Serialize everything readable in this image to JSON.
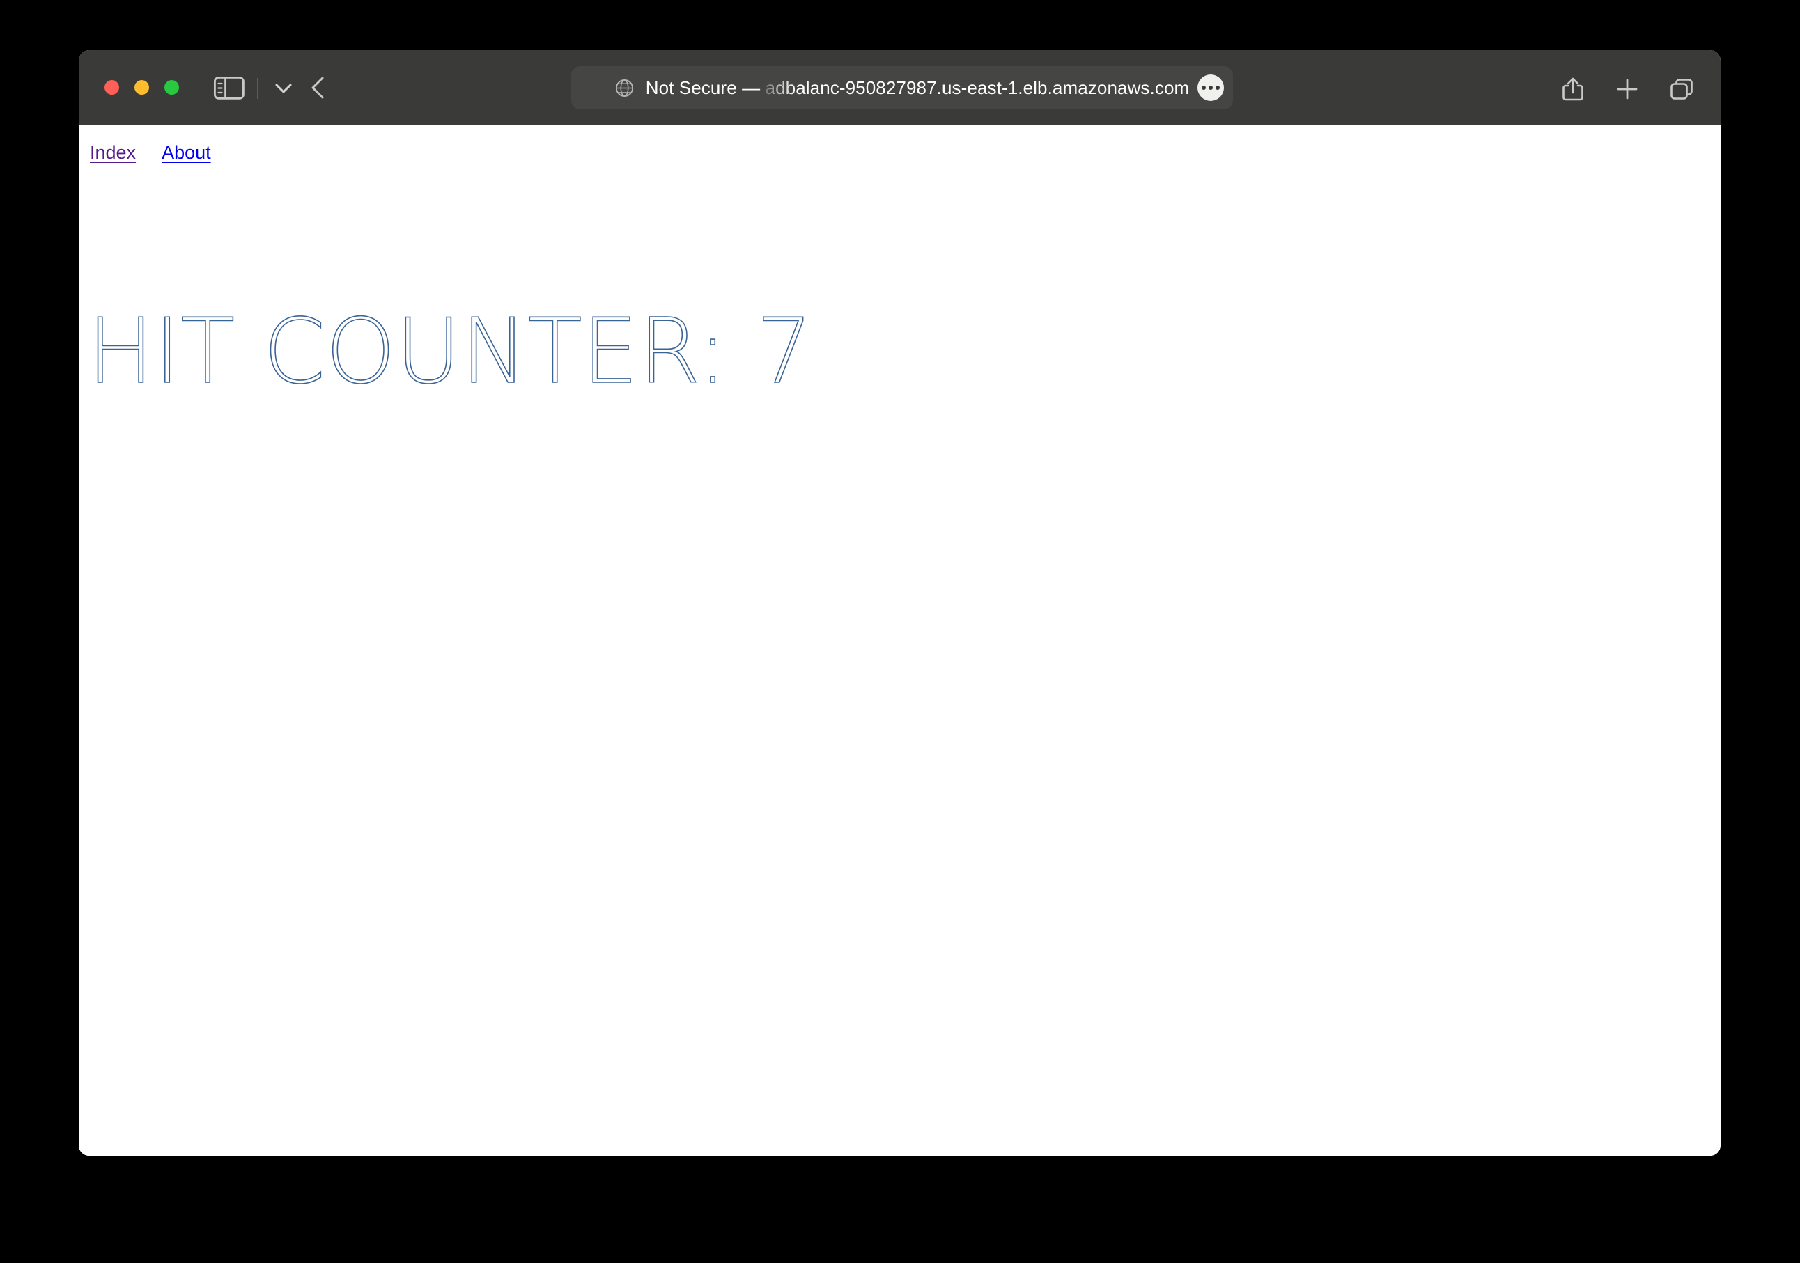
{
  "window": {
    "traffic_lights": [
      {
        "name": "close",
        "color": "#ff5f57"
      },
      {
        "name": "minimize",
        "color": "#febc2e"
      },
      {
        "name": "zoom",
        "color": "#28c840"
      }
    ]
  },
  "toolbar": {
    "sidebar_icon": "sidebar-icon",
    "dropdown_icon": "chevron-down-icon",
    "back_icon": "back-chevron-icon",
    "share_icon": "share-icon",
    "new_tab_icon": "plus-icon",
    "tab_overview_icon": "tab-overview-icon",
    "background_color": "#3a3a38"
  },
  "url_bar": {
    "globe_icon": "globe-icon",
    "security_label": "Not Secure",
    "separator": "—",
    "host": "adbalanc-950827987.us-east-1.elb.amazonaws.com",
    "full_text": "Not Secure — adbalanc-950827987.us-east-1.elb.amazonaws.com",
    "more_button_icon": "ellipsis-icon",
    "background_color": "#454543"
  },
  "page": {
    "nav": [
      {
        "label": "Index",
        "state": "visited",
        "color": "#551a8b"
      },
      {
        "label": "About",
        "state": "unvisited",
        "color": "#0000ee"
      }
    ],
    "heading": "HIT COUNTER: 7",
    "heading_color": "#3a6496",
    "counter_label": "HIT COUNTER:",
    "counter_value": "7",
    "background_color": "#ffffff"
  }
}
